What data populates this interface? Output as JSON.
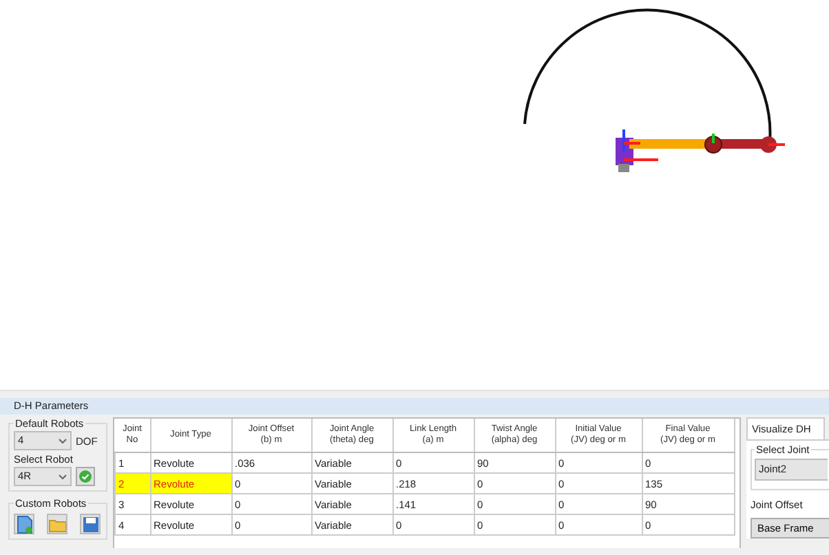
{
  "panel_title": "D-H Parameters",
  "default_robots": {
    "title": "Default Robots",
    "dof_value": "4",
    "dof_label": "DOF",
    "select_label": "Select Robot",
    "robot_value": "4R"
  },
  "custom_robots": {
    "title": "Custom Robots"
  },
  "table": {
    "columns": [
      {
        "lines": [
          "Joint",
          "No"
        ]
      },
      {
        "lines": [
          "Joint Type"
        ]
      },
      {
        "lines": [
          "Joint Offset",
          "(b)  m"
        ]
      },
      {
        "lines": [
          "Joint Angle",
          "(theta)  deg"
        ]
      },
      {
        "lines": [
          "Link Length",
          "(a)  m"
        ]
      },
      {
        "lines": [
          "Twist Angle",
          "(alpha)  deg"
        ]
      },
      {
        "lines": [
          "Initial Value",
          "(JV)   deg or m"
        ]
      },
      {
        "lines": [
          "Final Value",
          "(JV)   deg or m"
        ]
      }
    ],
    "rows": [
      {
        "selected": false,
        "cells": [
          "1",
          "Revolute",
          ".036",
          "Variable",
          "0",
          "90",
          "0",
          "0"
        ]
      },
      {
        "selected": true,
        "cells": [
          "2",
          "Revolute",
          "0",
          "Variable",
          ".218",
          "0",
          "0",
          "135"
        ]
      },
      {
        "selected": false,
        "cells": [
          "3",
          "Revolute",
          "0",
          "Variable",
          ".141",
          "0",
          "0",
          "90"
        ]
      },
      {
        "selected": false,
        "cells": [
          "4",
          "Revolute",
          "0",
          "Variable",
          "0",
          "0",
          "0",
          "0"
        ]
      }
    ]
  },
  "visualize": {
    "tab": "Visualize DH",
    "group": "Select Joint",
    "joint_value": "Joint2",
    "offset_label": "Joint Offset",
    "base_button": "Base Frame"
  }
}
